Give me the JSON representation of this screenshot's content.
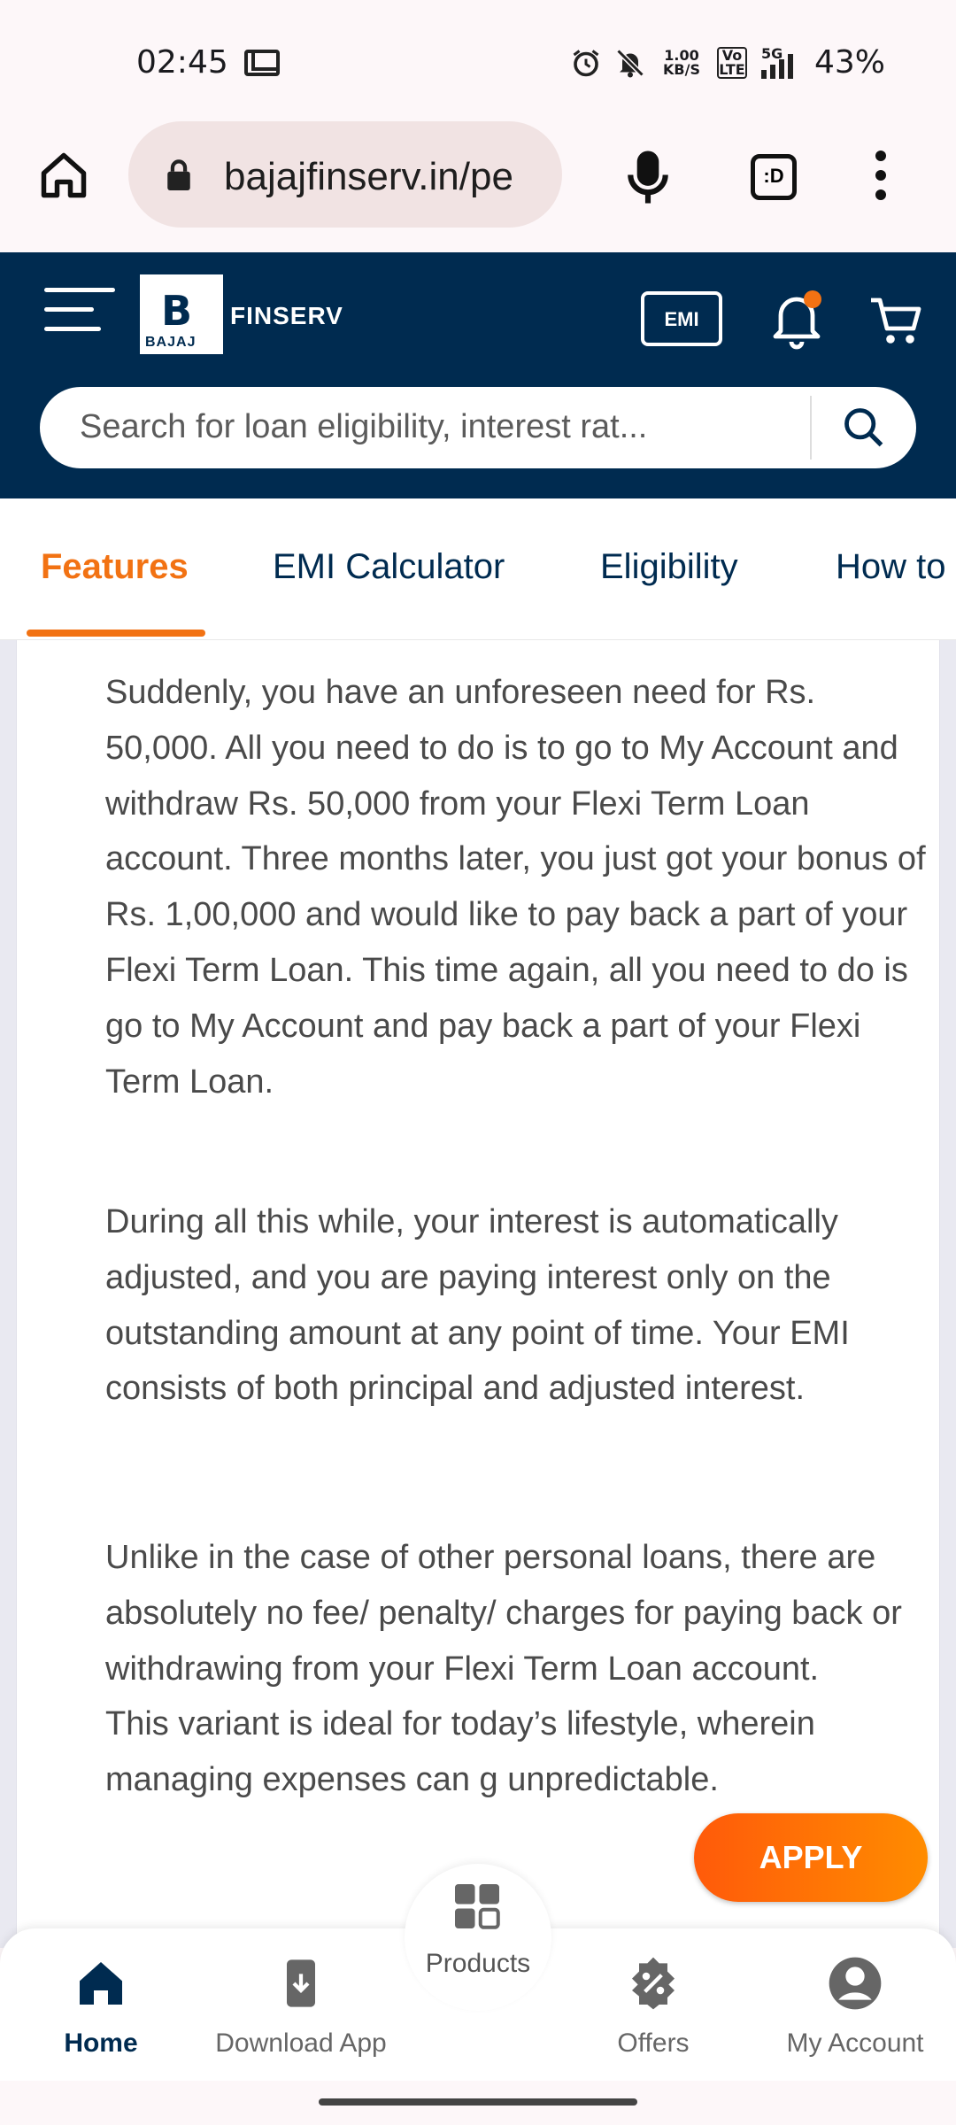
{
  "status_bar": {
    "time": "02:45",
    "data_speed": "1.00\nKB/S",
    "network_badge": "Vo\nLTE",
    "network_type": "5G",
    "battery": "43%"
  },
  "browser": {
    "url": "bajajfinserv.in/pe",
    "tabs_label": ":D"
  },
  "header": {
    "logo_letter": "B",
    "logo_sub": "BAJAJ",
    "brand": "FINSERV",
    "emi_label": "EMI",
    "notification_color": "#f27213",
    "search_placeholder": "Search for loan eligibility, interest rat..."
  },
  "tabs": [
    {
      "label": "Features",
      "active": true
    },
    {
      "label": "EMI Calculator",
      "active": false
    },
    {
      "label": "Eligibility",
      "active": false
    },
    {
      "label": "How to",
      "active": false
    }
  ],
  "content": {
    "para1": "Suddenly, you have an unforeseen need for Rs. 50,000. All you need to do is to go to My Account and withdraw Rs. 50,000 from your Flexi Term Loan account. Three months later, you just got your bonus of Rs. 1,00,000 and would like to pay back a part of your Flexi Term Loan. This time again, all you need to do is go to My Account and pay back a part of your Flexi Term Loan.",
    "para2": "During all this while, your interest is automatically adjusted, and you are paying interest only on the outstanding amount at any point of time. Your EMI consists of both principal and adjusted interest.",
    "para3": "Unlike in the case of other personal loans, there are absolutely no fee/ penalty/ charges for paying back or withdrawing from your Flexi Term Loan account.",
    "para4": "This variant is ideal for today’s lifestyle, wherein managing expenses can g unpredictable."
  },
  "apply_label": "APPLY",
  "bottom_nav": {
    "home": "Home",
    "download": "Download App",
    "products": "Products",
    "offers": "Offers",
    "account": "My Account"
  },
  "colors": {
    "navy": "#002b50",
    "accent": "#f27213"
  }
}
